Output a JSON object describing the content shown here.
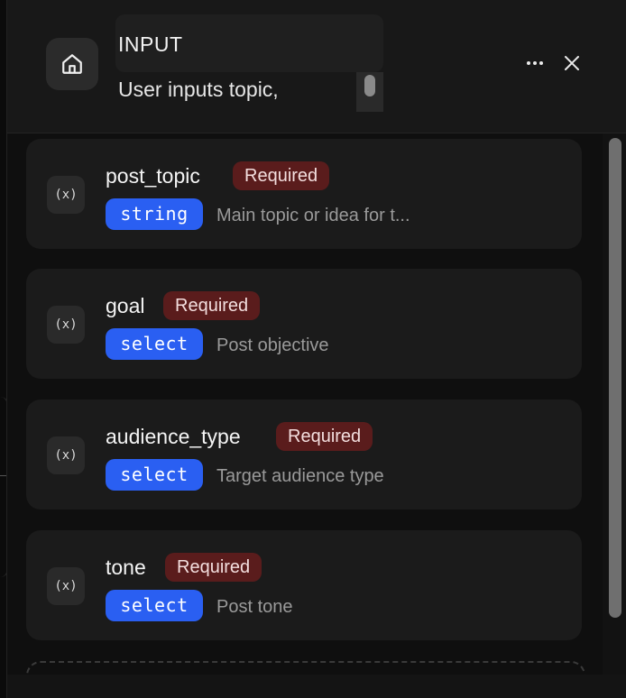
{
  "node": {
    "title": "INPUT",
    "description": "User inputs topic,",
    "icon": "home-icon"
  },
  "header_actions": {
    "more_icon": "more-horizontal-icon",
    "close_icon": "close-icon"
  },
  "variables": [
    {
      "name": "post_topic",
      "required_label": "Required",
      "type": "string",
      "description": "Main topic or idea for t..."
    },
    {
      "name": "goal",
      "required_label": "Required",
      "type": "select",
      "description": "Post objective"
    },
    {
      "name": "audience_type",
      "required_label": "Required",
      "type": "select",
      "description": "Target audience type"
    },
    {
      "name": "tone",
      "required_label": "Required",
      "type": "select",
      "description": "Post tone"
    }
  ],
  "variable_icon": "variable-icon",
  "colors": {
    "required_bg": "#5a1c1c",
    "type_badge_bg": "#2a5ff2",
    "panel_bg": "#141414",
    "card_bg": "#1b1b1b"
  }
}
